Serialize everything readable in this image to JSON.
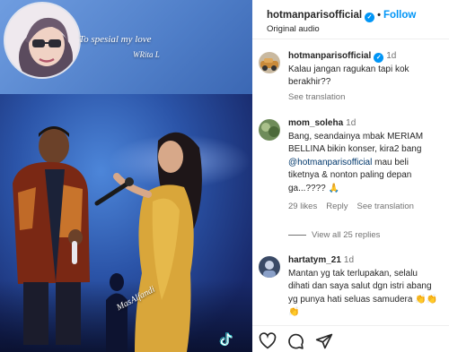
{
  "media": {
    "dedication": "To spesial my love",
    "signature": "WRita L",
    "caption": "MasAlfandi"
  },
  "post_header": {
    "username": "hotmanparisofficial",
    "follow_label": "Follow",
    "audio": "Original audio",
    "separator": "•"
  },
  "caption_comment": {
    "username": "hotmanparisofficial",
    "time": "1d",
    "text": "Kalau jangan ragukan tapi kok berakhir??",
    "see_translation": "See translation"
  },
  "comments": [
    {
      "username": "mom_soleha",
      "time": "1d",
      "text_before": "Bang, seandainya mbak MERIAM BELLINA bikin konser, kira2 bang ",
      "mention": "@hotmanparisofficial",
      "text_after": " mau beli tiketnya & nonton paling depan ga...???? 🙏",
      "likes": "29 likes",
      "reply": "Reply",
      "see_translation": "See translation"
    },
    {
      "username": "hartatym_21",
      "time": "1d",
      "text": "Mantan yg tak terlupakan, selalu dihati dan saya salut dgn istri abang yg punya hati seluas samudera 👏👏👏"
    }
  ],
  "view_all_replies": "View all 25 replies",
  "icons": [
    "heart-icon",
    "comment-icon",
    "share-icon",
    "verified-icon",
    "tiktok-icon"
  ],
  "colors": {
    "link_blue": "#0095f6",
    "verified_blue": "#0095f6",
    "muted": "#737373",
    "mention": "#00376b"
  }
}
